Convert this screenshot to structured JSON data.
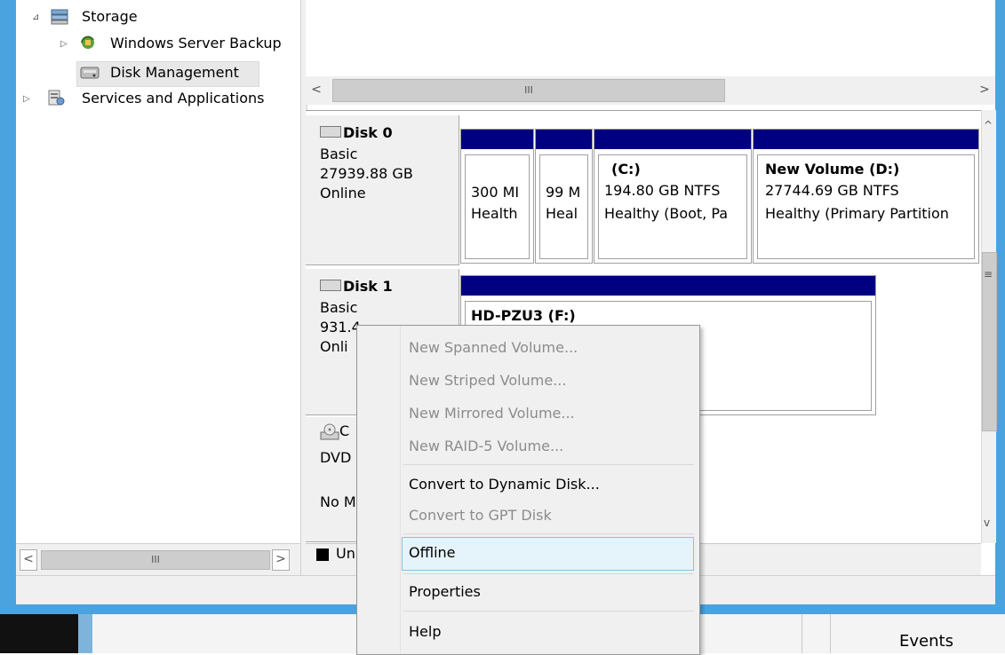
{
  "tree": {
    "items": [
      {
        "label": "Storage",
        "expand": "⊿",
        "icon": "storage-icon"
      },
      {
        "label": "Windows Server Backup",
        "expand": "▷",
        "icon": "backup-icon"
      },
      {
        "label": "Disk Management",
        "expand": "",
        "icon": "disk-management-icon"
      },
      {
        "label": "Services and Applications",
        "expand": "▷",
        "icon": "services-icon"
      }
    ]
  },
  "scroll": {
    "left": "<",
    "right": ">",
    "thumb": "III",
    "up": "^",
    "down": "v",
    "grip": "≡"
  },
  "disks": [
    {
      "name": "Disk 0",
      "type": "Basic",
      "size": "27939.88 GB",
      "status": "Online",
      "partitions": [
        {
          "title": "",
          "line1": "300 MI",
          "line2": "Health"
        },
        {
          "title": "",
          "line1": "99 M",
          "line2": "Heal"
        },
        {
          "title": "(C:)",
          "line1": "194.80 GB NTFS",
          "line2": "Healthy (Boot, Pa"
        },
        {
          "title": "New Volume  (D:)",
          "line1": "27744.69 GB NTFS",
          "line2": "Healthy (Primary Partition"
        }
      ]
    },
    {
      "name": "Disk 1",
      "type": "Basic",
      "size": "931.4",
      "status": "Onli",
      "partitions": [
        {
          "title": "HD-PZU3  (F:)",
          "line1": "",
          "line2": ""
        }
      ]
    },
    {
      "name": "C",
      "type": "DVD",
      "size": "",
      "status": "No M",
      "partitions": []
    }
  ],
  "legend": {
    "unallocated": "Un"
  },
  "context_menu": {
    "items": [
      {
        "label": "New Spanned Volume...",
        "enabled": false
      },
      {
        "label": "New Striped Volume...",
        "enabled": false
      },
      {
        "label": "New Mirrored Volume...",
        "enabled": false
      },
      {
        "label": "New RAID-5 Volume...",
        "enabled": false
      },
      {
        "label": "Convert to Dynamic Disk...",
        "enabled": true
      },
      {
        "label": "Convert to GPT Disk",
        "enabled": false
      },
      {
        "label": "Offline",
        "enabled": true,
        "highlighted": true
      },
      {
        "label": "Properties",
        "enabled": true
      },
      {
        "label": "Help",
        "enabled": true
      }
    ]
  },
  "bottom": {
    "events_label": "Events"
  },
  "colors": {
    "accent": "#4aa3df",
    "partition_bar": "#000080",
    "highlight": "#e5f3fb"
  }
}
